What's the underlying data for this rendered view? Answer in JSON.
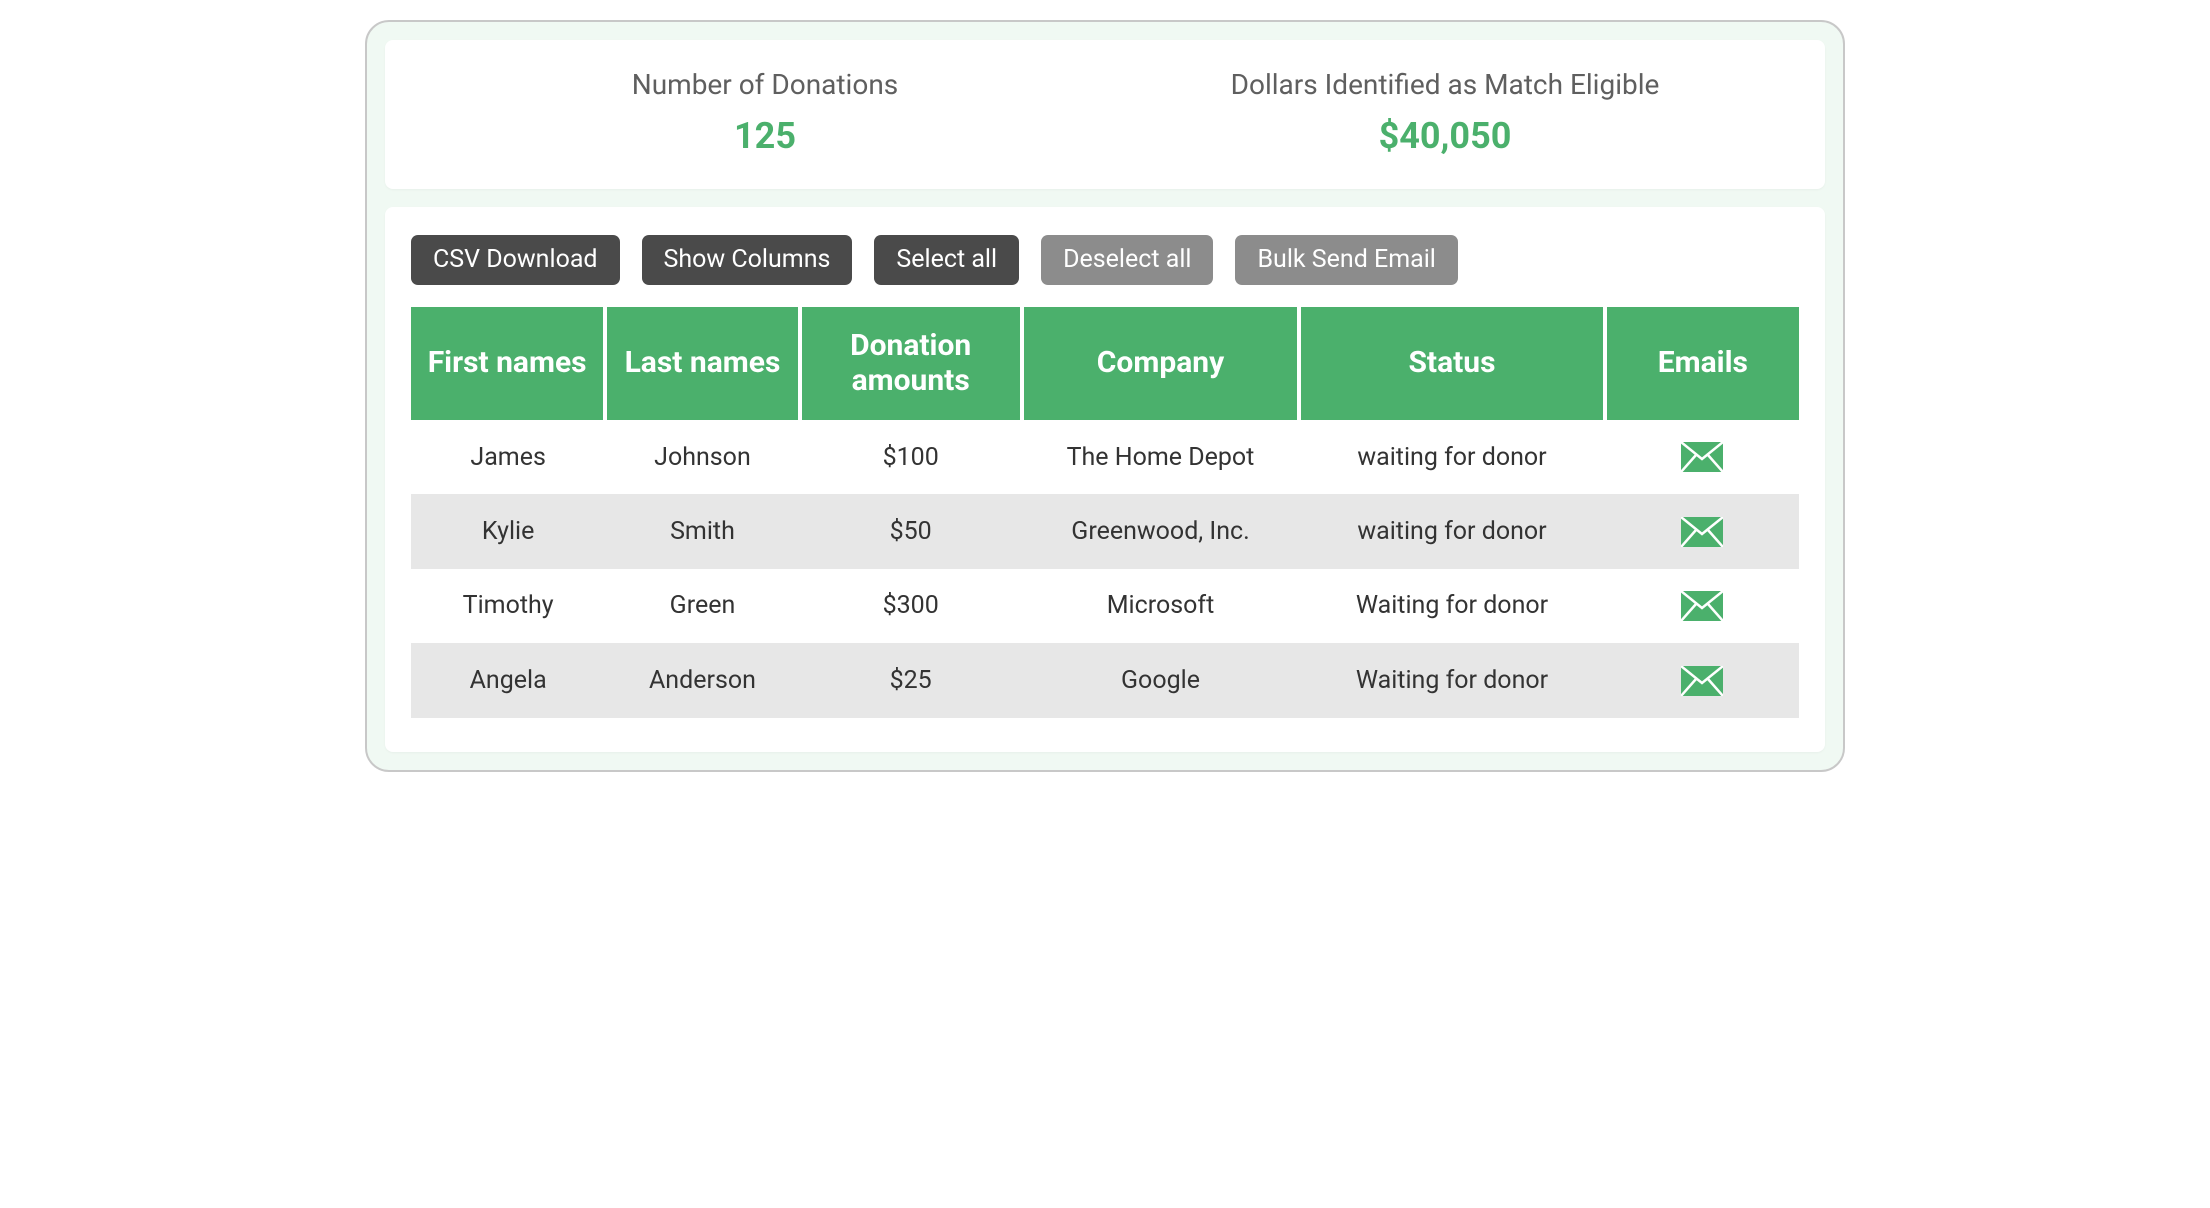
{
  "stats": {
    "donations_label": "Number of Donations",
    "donations_value": "125",
    "match_label": "Dollars Identified as Match Eligible",
    "match_value": "$40,050"
  },
  "toolbar": {
    "csv_download": "CSV Download",
    "show_columns": "Show Columns",
    "select_all": "Select all",
    "deselect_all": "Deselect all",
    "bulk_send_email": "Bulk Send Email"
  },
  "table": {
    "headers": {
      "first_names": "First names",
      "last_names": "Last names",
      "donation_amounts": "Donation amounts",
      "company": "Company",
      "status": "Status",
      "emails": "Emails"
    },
    "rows": [
      {
        "first_name": "James",
        "last_name": "Johnson",
        "amount": "$100",
        "company": "The Home Depot",
        "status": "waiting for donor"
      },
      {
        "first_name": "Kylie",
        "last_name": "Smith",
        "amount": "$50",
        "company": "Greenwood, Inc.",
        "status": "waiting for donor"
      },
      {
        "first_name": "Timothy",
        "last_name": "Green",
        "amount": "$300",
        "company": "Microsoft",
        "status": "Waiting for donor"
      },
      {
        "first_name": "Angela",
        "last_name": "Anderson",
        "amount": "$25",
        "company": "Google",
        "status": "Waiting for donor"
      }
    ]
  },
  "colors": {
    "accent": "#4bb06c",
    "btn_dark": "#4a4a4a",
    "btn_light": "#8c8c8c"
  }
}
